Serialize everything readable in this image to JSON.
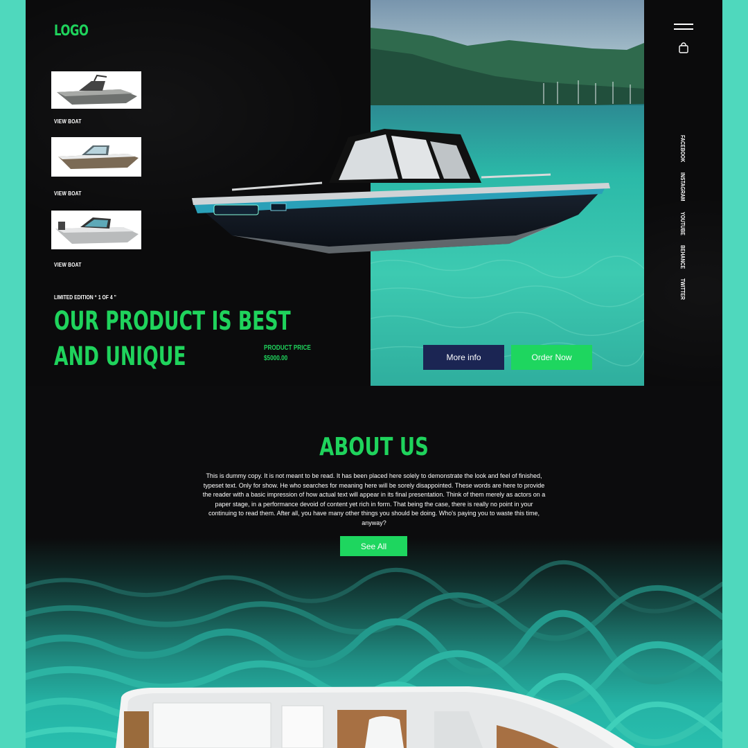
{
  "header": {
    "logo": "LOGO",
    "menu_icon": "hamburger-menu-icon",
    "cart_icon": "shopping-bag-icon"
  },
  "thumbnails": [
    {
      "label": "VIEW BOAT"
    },
    {
      "label": "VIEW BOAT"
    },
    {
      "label": "VIEW BOAT"
    }
  ],
  "hero": {
    "edition": "LIMITED EDITION “ 1 OF 4 ”",
    "headline_line1": "OUR PRODUCT IS BEST",
    "headline_line2": "AND UNIQUE",
    "price_label": "PRODUCT PRICE",
    "price_value": "$5000.00",
    "more_info": "More info",
    "order_now": "Order Now"
  },
  "socials": [
    "FACEBOOK",
    "INSTAGRAM",
    "YOUTUBE",
    "BEHANCE",
    "TWITTER"
  ],
  "about": {
    "title": "ABOUT US",
    "text": "This is dummy copy. It is not meant to be read. It has been placed here solely to demonstrate the look and feel of finished, typeset text. Only for show. He who searches for meaning here will be sorely disappointed.  These words are here to provide the reader with a basic impression of how actual text will appear in its final presentation. Think of them merely as actors on a paper stage, in a performance devoid of content yet rich in form. That being the case, there is really no point in your continuing to read them. After all, you have many other things you should be doing. Who's paying you to waste this time, anyway?",
    "see_all": "See All"
  },
  "colors": {
    "accent_green": "#1ed65f",
    "navy": "#1b2553",
    "frame_teal": "#4fd8bd",
    "background": "#0c0c0d"
  }
}
